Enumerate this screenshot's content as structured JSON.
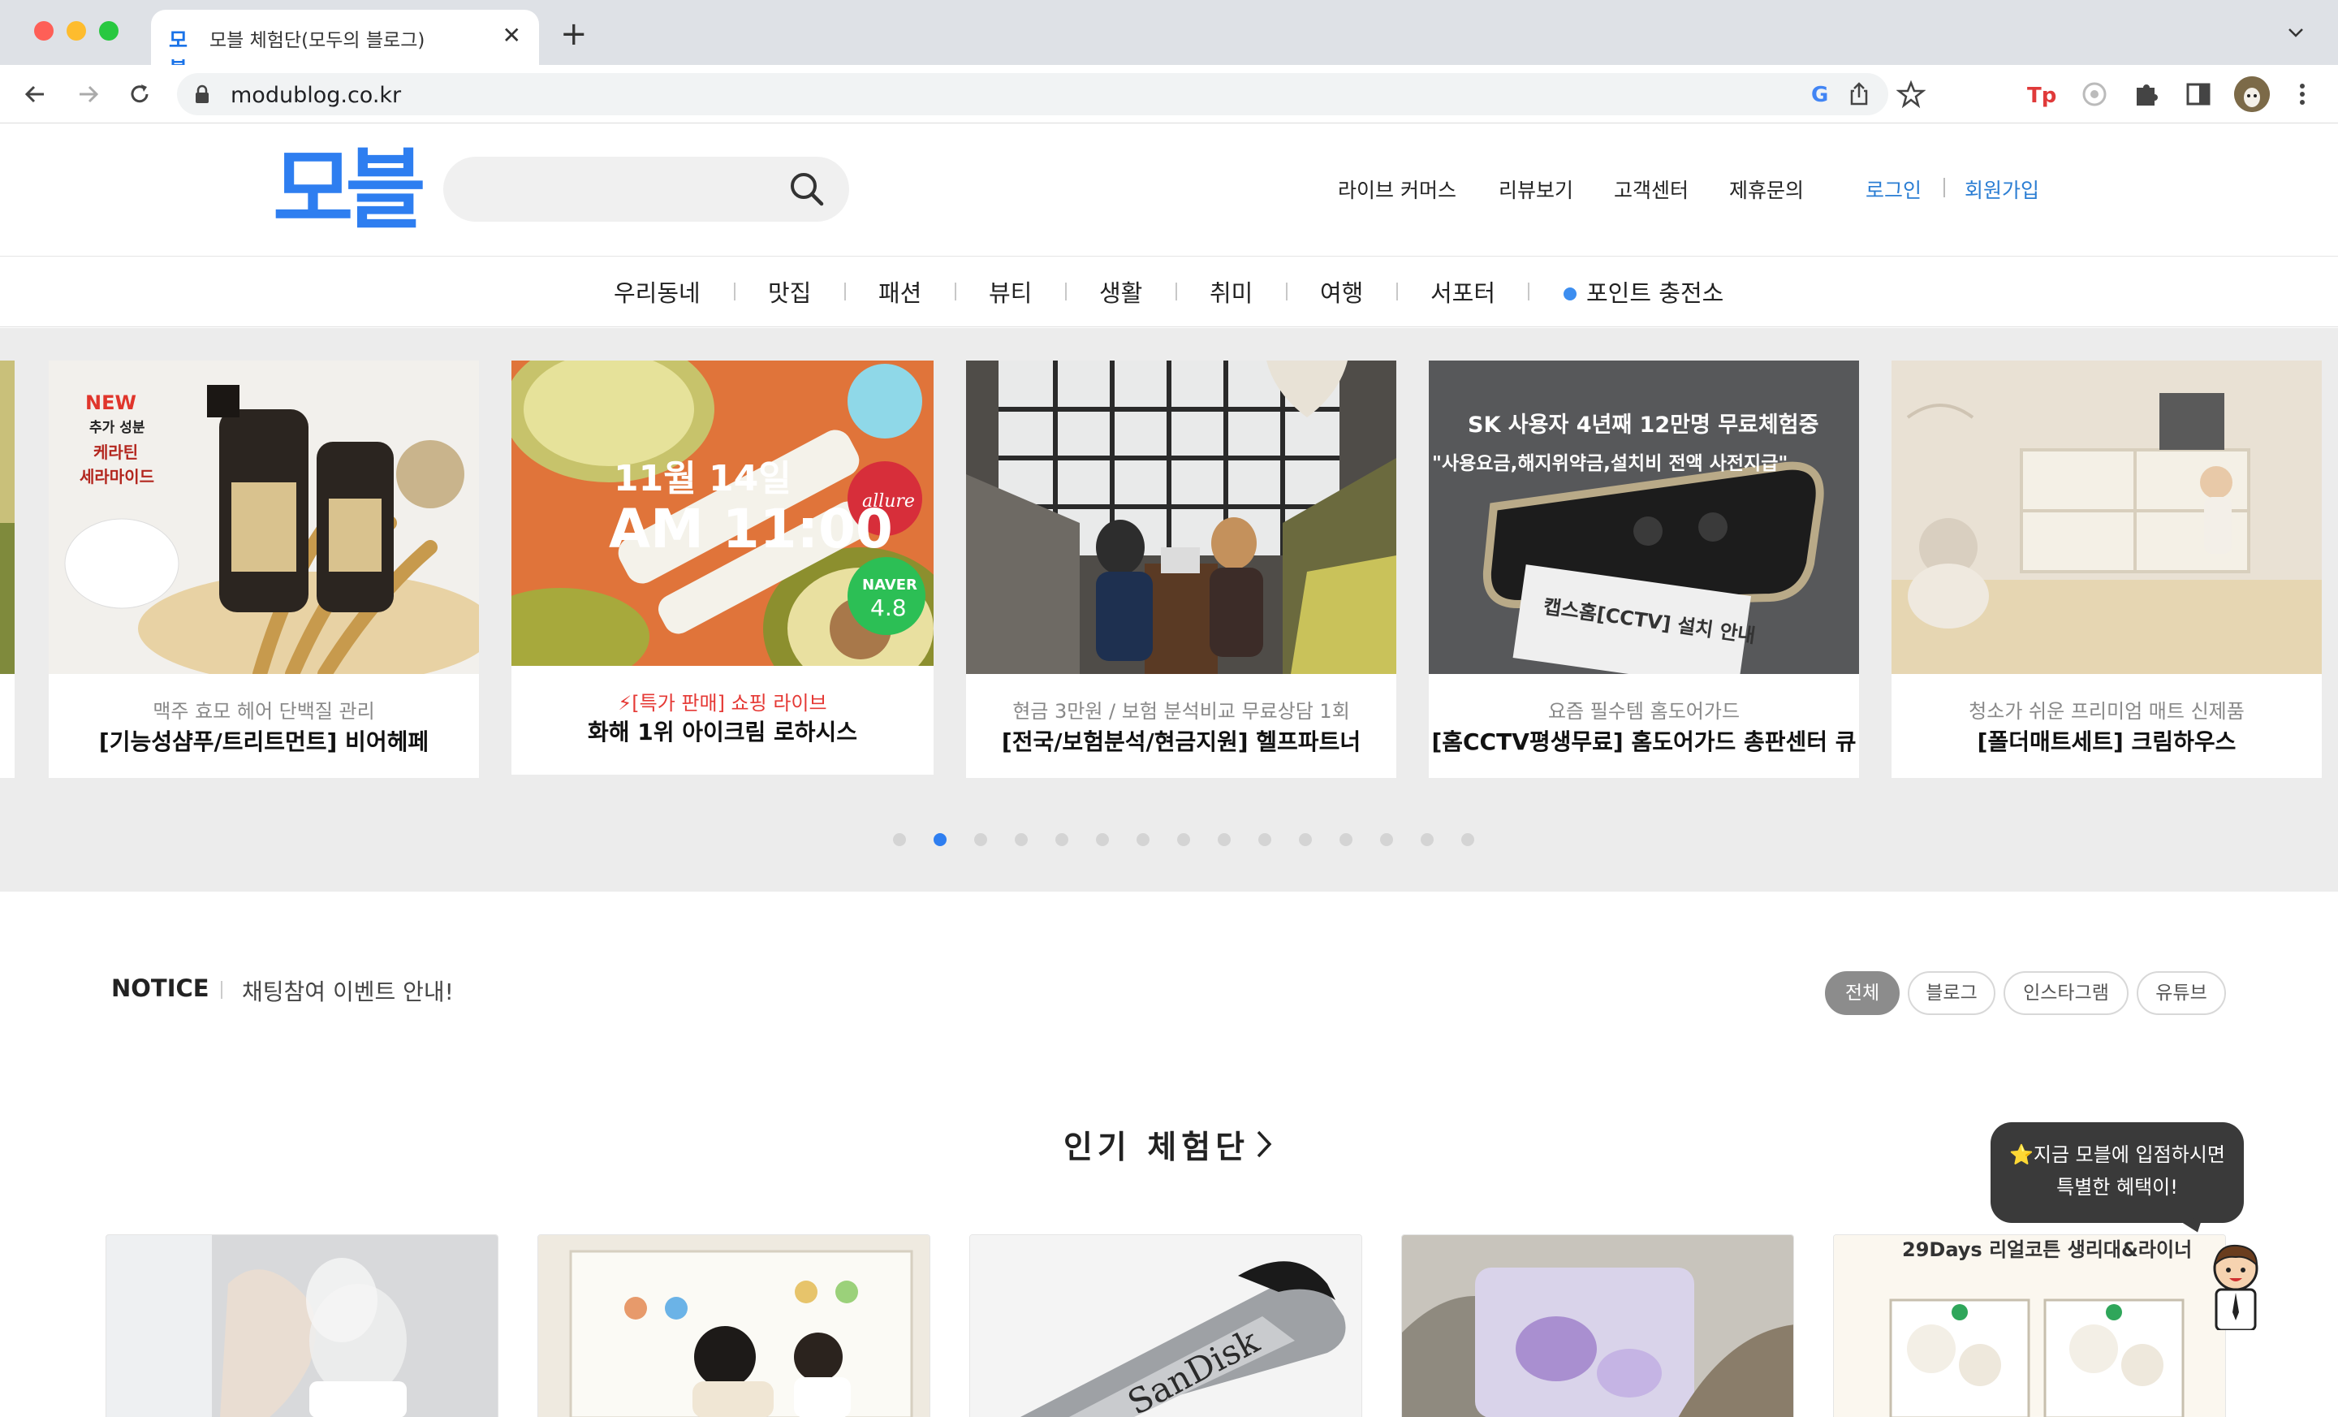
{
  "browser": {
    "tab_title": "모블 체험단(모두의 블로그)",
    "tab_favicon": "모블",
    "url": "modublog.co.kr"
  },
  "header": {
    "logo": "모블",
    "search_placeholder": "",
    "nav": [
      "라이브 커머스",
      "리뷰보기",
      "고객센터",
      "제휴문의"
    ],
    "login": "로그인",
    "signup": "회원가입"
  },
  "categories": [
    "우리동네",
    "맛집",
    "패션",
    "뷰티",
    "생활",
    "취미",
    "여행",
    "서포터",
    "포인트 충전소"
  ],
  "slider": {
    "cards": [
      {
        "subtitle": "맥주 효모 헤어 단백질 관리",
        "title": "[기능성샴푸/트리트먼트] 비어헤페"
      },
      {
        "subtitle": "⚡[특가 판매] 쇼핑 라이브",
        "title": "화해 1위 아이크림 로하시스"
      },
      {
        "subtitle": "현금 3만원 / 보험 분석비교 무료상담 1회",
        "title": "[전국/보험분석/현금지원] 헬프파트너"
      },
      {
        "subtitle": "요즘 필수템 홈도어가드",
        "title": "[홈CCTV평생무료] 홈도어가드 총판센터 큐"
      },
      {
        "subtitle": "청소가 쉬운 프리미엄 매트 신제품",
        "title": "[폴더매트세트] 크림하우스"
      }
    ],
    "img_text": {
      "new_badge": "NEW",
      "new_sub": "추가 성분",
      "keratin": "케라틴",
      "ceramide": "세라마이드",
      "date": "11월 14일",
      "time": "AM 11:00",
      "allure": "allure",
      "naver": "NAVER",
      "naver_score": "4.8",
      "cctv_line1": "SK 사용자 4년째 12만명 무료체험중",
      "cctv_line2": "\"사용요금,해지위약금,설치비 전액 사전지급\"",
      "cctv_sign": "캡스홈[CCTV] 설치 안내"
    },
    "dot_count": 15,
    "active_dot": 1
  },
  "notice": {
    "label": "NOTICE",
    "text": "채팅참여 이벤트 안내!",
    "filters": [
      "전체",
      "블로그",
      "인스타그램",
      "유튜브"
    ],
    "active_filter": "전체"
  },
  "popular": {
    "title": "인기 체험단",
    "card5_title": "29Days 리얼코튼 생리대&라이너",
    "sandisk": "SanDisk"
  },
  "promo": {
    "line1": "⭐지금 모블에 입점하시면",
    "line2": "특별한 혜택이!"
  },
  "colors": {
    "brand": "#2e7ef0",
    "link": "#2a7dd3",
    "live_red": "#e53935"
  }
}
